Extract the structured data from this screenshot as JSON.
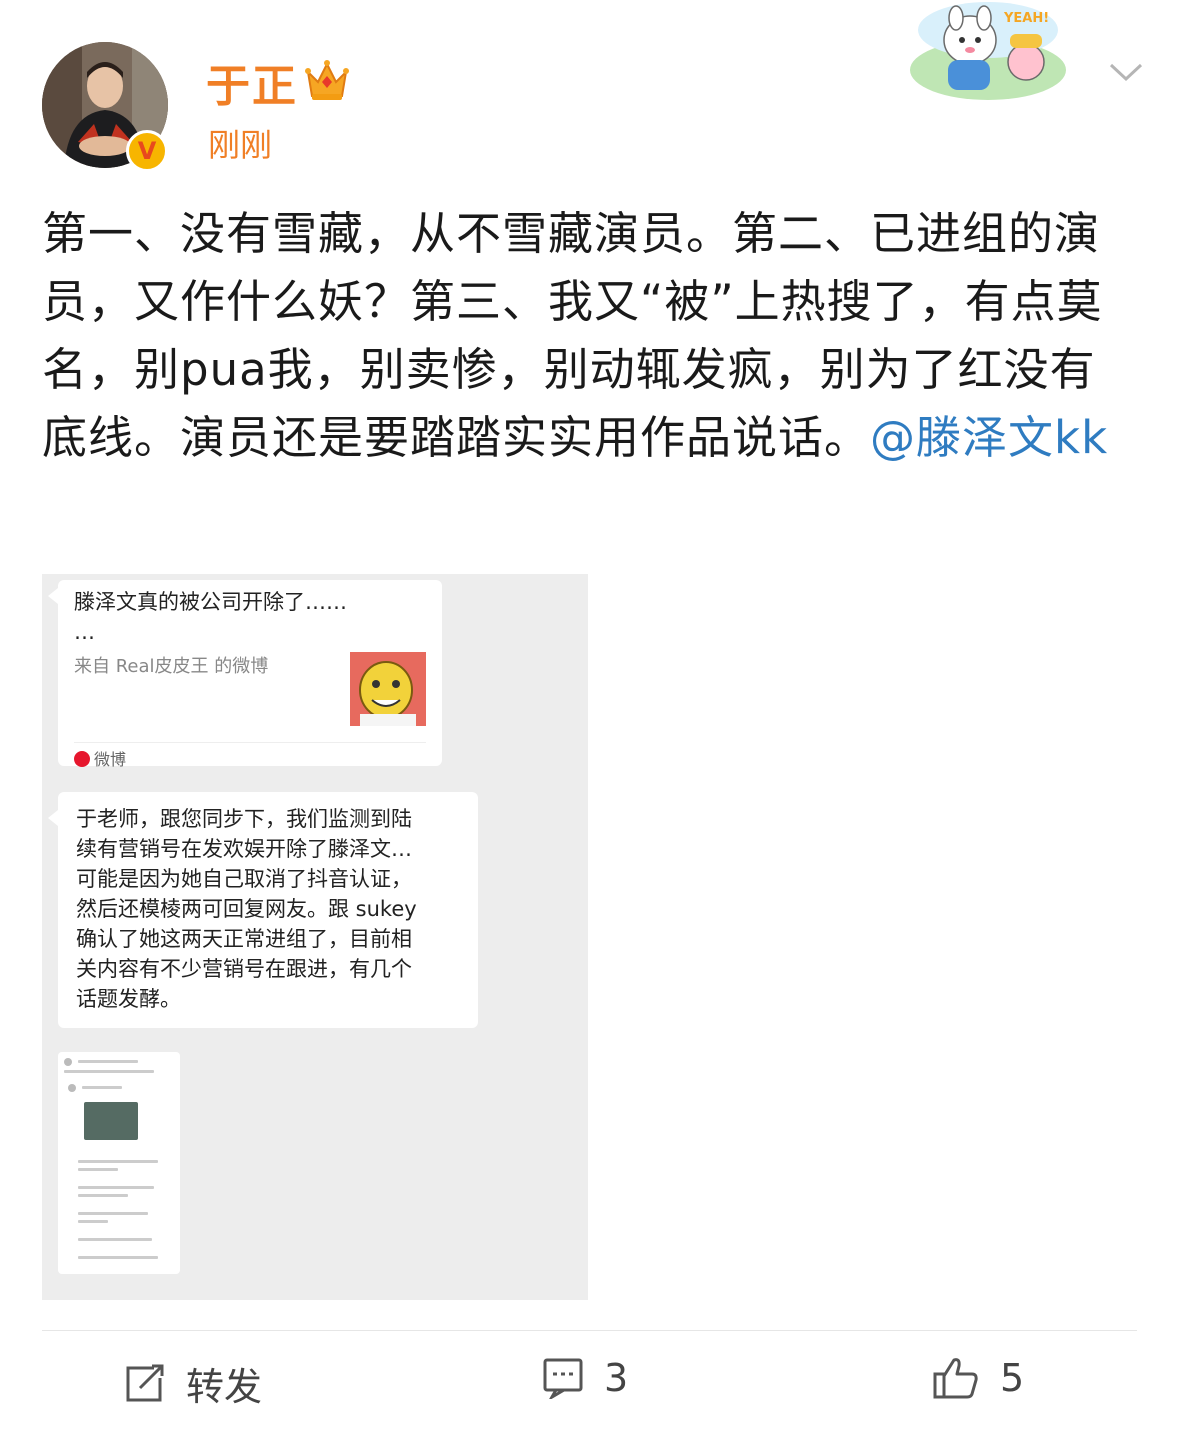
{
  "header": {
    "username": "于正",
    "time": "刚刚",
    "badge_letter": "V",
    "brand_color": "#f07f26",
    "icons": [
      "crown-icon",
      "verified-badge-icon",
      "yeah-sticker",
      "chevron-down-icon"
    ],
    "sticker_text": "YEAH!"
  },
  "post": {
    "text": "第一、没有雪藏，从不雪藏演员。第二、已进组的演员，又作什么妖？第三、我又“被”上热搜了，有点莫名，别pua我，别卖惨，别动辄发疯，别为了红没有底线。演员还是要踏踏实实用作品说话。",
    "mention": "@滕泽文kk",
    "mention_color": "#2f7cc1"
  },
  "image": {
    "card1": {
      "title": "滕泽文真的被公司开除了……",
      "ellipsis": "…",
      "source": "来自 Real皮皮王 的微博",
      "app": "微博"
    },
    "card2": {
      "lines": [
        "于老师，跟您同步下，我们监测到陆",
        "续有营销号在发欢娱开除了滕泽文…",
        "可能是因为她自己取消了抖音认证，",
        "然后还模棱两可回复网友。跟 sukey",
        "确认了她这两天正常进组了，目前相",
        "关内容有不少营销号在跟进，有几个",
        "话题发酵。"
      ]
    }
  },
  "actions": {
    "repost_label": "转发",
    "comment_count": "3",
    "like_count": "5"
  }
}
